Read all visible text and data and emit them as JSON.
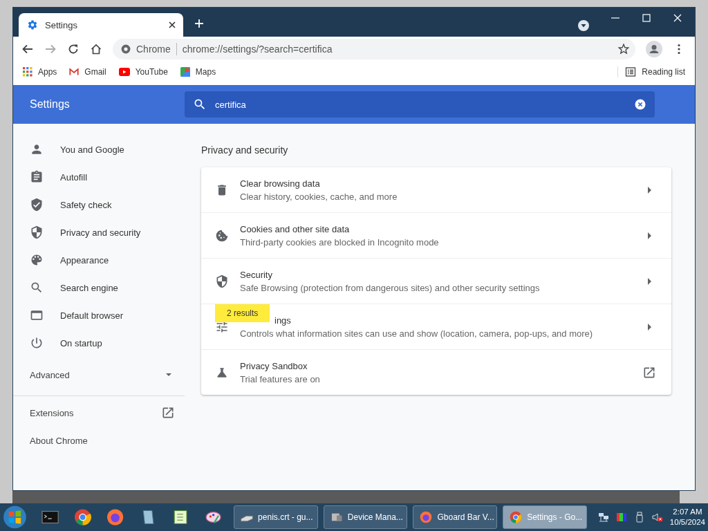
{
  "browser": {
    "tab": {
      "title": "Settings"
    },
    "omnibox": {
      "origin": "Chrome",
      "url": "chrome://settings/?search=certifica"
    },
    "bookmarks": [
      {
        "label": "Apps"
      },
      {
        "label": "Gmail"
      },
      {
        "label": "YouTube"
      },
      {
        "label": "Maps"
      }
    ],
    "reading_list": "Reading list"
  },
  "settings": {
    "title": "Settings",
    "search": {
      "value": "certifica"
    },
    "sidebar": {
      "items": [
        {
          "label": "You and Google"
        },
        {
          "label": "Autofill"
        },
        {
          "label": "Safety check"
        },
        {
          "label": "Privacy and security"
        },
        {
          "label": "Appearance"
        },
        {
          "label": "Search engine"
        },
        {
          "label": "Default browser"
        },
        {
          "label": "On startup"
        }
      ],
      "advanced": {
        "label": "Advanced",
        "expanded": false
      },
      "links": [
        {
          "label": "Extensions",
          "external": true
        },
        {
          "label": "About Chrome",
          "external": false
        }
      ]
    },
    "section": {
      "title": "Privacy and security",
      "rows": [
        {
          "title": "Clear browsing data",
          "subtitle": "Clear history, cookies, cache, and more",
          "external": false,
          "covered": false
        },
        {
          "title": "Cookies and other site data",
          "subtitle": "Third-party cookies are blocked in Incognito mode",
          "external": false,
          "covered": false
        },
        {
          "title": "Security",
          "subtitle": "Safe Browsing (protection from dangerous sites) and other security settings",
          "external": false,
          "covered": false
        },
        {
          "title": "ings",
          "subtitle": "Controls what information sites can use and show (location, camera, pop-ups, and more)",
          "external": false,
          "covered": true
        },
        {
          "title": "Privacy Sandbox",
          "subtitle": "Trial features are on",
          "external": true,
          "covered": false
        }
      ]
    },
    "search_bubble": "2 results"
  },
  "taskbar": {
    "tasks": [
      {
        "label": "penis.crt - gu...",
        "selected": false
      },
      {
        "label": "Device Mana...",
        "selected": false
      },
      {
        "label": "Gboard Bar V...",
        "selected": false
      },
      {
        "label": "Settings - Go...",
        "selected": true
      }
    ],
    "clock": {
      "time": "2:07 AM",
      "date": "10/5/2024"
    }
  }
}
